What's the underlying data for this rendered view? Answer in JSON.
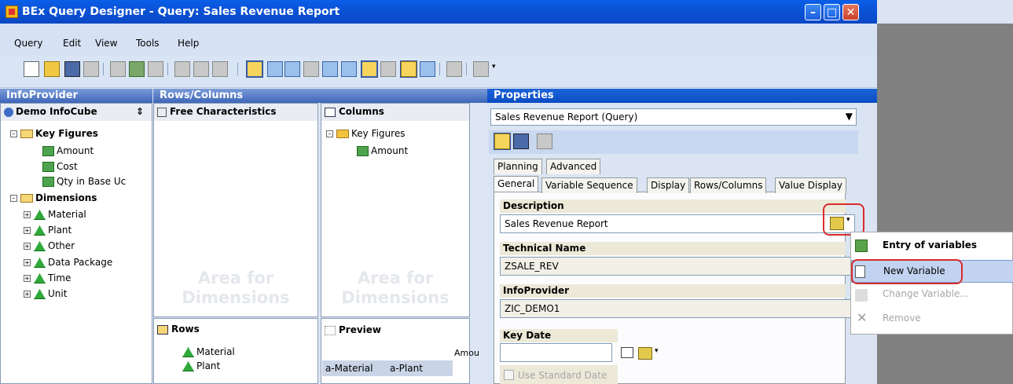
{
  "title": "BEx Query Designer - Query: Sales Revenue Report",
  "menu": [
    "Query",
    "Edit",
    "View",
    "Tools",
    "Help"
  ],
  "infoprovider": {
    "header": "InfoProvider",
    "cube": "Demo InfoCube",
    "key_figures_label": "Key Figures",
    "key_figures": [
      "Amount",
      "Cost",
      "Qty in Base Uc"
    ],
    "dimensions_label": "Dimensions",
    "dimensions": [
      "Material",
      "Plant",
      "Other",
      "Data Package",
      "Time",
      "Unit"
    ]
  },
  "rows_columns": {
    "header": "Rows/Columns",
    "free_chars": "Free Characteristics",
    "columns": "Columns",
    "col_tree_parent": "Key Figures",
    "col_tree_child": "Amount",
    "area_text": "Area for Dimensions",
    "rows": "Rows",
    "rows_items": [
      "Material",
      "Plant"
    ],
    "preview": "Preview",
    "preview_col": "Amou",
    "preview_cells": [
      "a-Material",
      "a-Plant"
    ]
  },
  "properties": {
    "header": "Properties",
    "selector": "Sales Revenue Report (Query)",
    "tabs_top": [
      "Planning",
      "Advanced"
    ],
    "tabs": [
      "General",
      "Variable Sequence",
      "Display",
      "Rows/Columns",
      "Value Display"
    ],
    "description_label": "Description",
    "description_value": "Sales Revenue Report",
    "technical_label": "Technical Name",
    "technical_value": "ZSALE_REV",
    "infoprovider_label": "InfoProvider",
    "infoprovider_value": "ZIC_DEMO1",
    "keydate_label": "Key Date",
    "use_standard_date": "Use Standard Date"
  },
  "context_menu": {
    "entry": "Entry of variables",
    "new": "New Variable",
    "change": "Change Variable...",
    "remove": "Remove"
  },
  "colors": {
    "title_blue": "#0b52d6",
    "highlight_red": "#d92b2b"
  }
}
